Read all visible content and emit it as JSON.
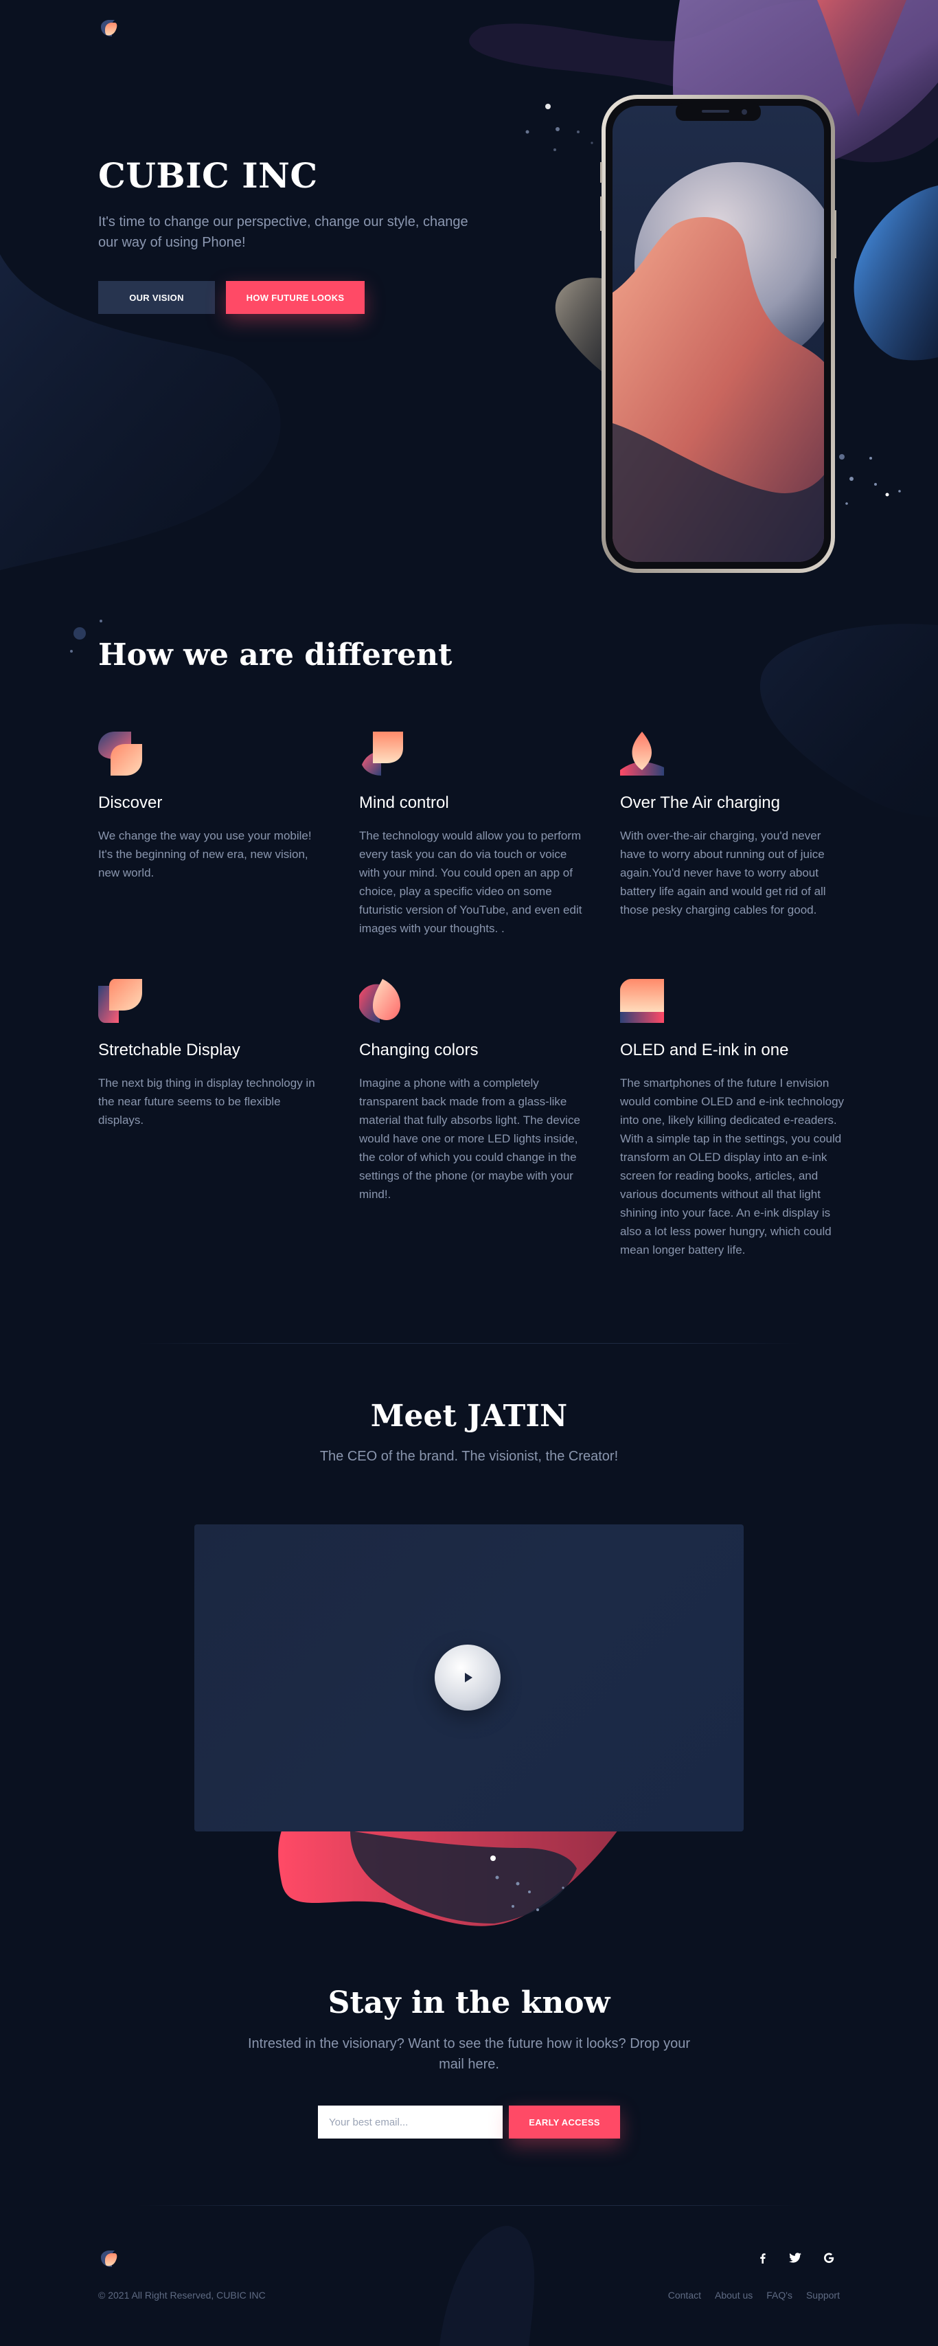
{
  "brand": {
    "name": "CUBIC INC",
    "logo_icon": "cubic-logo-icon"
  },
  "hero": {
    "title": "CUBIC INC",
    "text": "It's time to change our perspective, change our style, change our way of using Phone!",
    "btn_vision": "OUR VISION",
    "btn_future": "HOW FUTURE LOOKS"
  },
  "different": {
    "title": "How we are different",
    "features": [
      {
        "icon": "discover-icon",
        "title": "Discover",
        "text": "We change the way you use your mobile! It's the beginning of new era, new vision, new world."
      },
      {
        "icon": "mind-control-icon",
        "title": "Mind control",
        "text": "The technology would allow you to perform every task you can do via touch or voice with your mind. You could open an app of choice, play a specific video on some futuristic version of YouTube, and even edit images with your thoughts. ."
      },
      {
        "icon": "charging-icon",
        "title": "Over The Air charging",
        "text": "With over-the-air charging, you'd never have to worry about running out of juice again.You'd never have to worry about battery life again and would get rid of all those pesky charging cables for good."
      },
      {
        "icon": "stretchable-display-icon",
        "title": "Stretchable Display",
        "text": "The next big thing in display technology in the near future seems to be flexible displays."
      },
      {
        "icon": "changing-colors-icon",
        "title": "Changing colors",
        "text": "Imagine a phone with a completely transparent back made from a glass-like material that fully absorbs light. The device would have one or more LED lights inside, the color of which you could change in the settings of the phone (or maybe with your mind!."
      },
      {
        "icon": "oled-eink-icon",
        "title": "OLED and E-ink in one",
        "text": "The smartphones of the future I envision would combine OLED and e-ink technology into one, likely killing dedicated e-readers. With a simple tap in the settings, you could transform an OLED display into an e-ink screen for reading books, articles, and various documents without all that light shining into your face. An e-ink display is also a lot less power hungry, which could mean longer battery life."
      }
    ]
  },
  "meet": {
    "title": "Meet JATIN",
    "subtitle": "The CEO of the brand. The visionist, the Creator!",
    "play_icon": "play-icon"
  },
  "newsletter": {
    "title": "Stay in the know",
    "text": "Intrested in the visionary? Want to see the future how it looks? Drop your mail here.",
    "placeholder": "Your best email...",
    "button": "EARLY ACCESS"
  },
  "footer": {
    "copyright": "© 2021 All Right Reserved, CUBIC INC",
    "social": [
      {
        "icon": "facebook-icon",
        "glyph": "f"
      },
      {
        "icon": "twitter-icon",
        "glyph": "🐦"
      },
      {
        "icon": "google-icon",
        "glyph": "G"
      }
    ],
    "links": [
      "Contact",
      "About us",
      "FAQ's",
      "Support"
    ]
  },
  "colors": {
    "background": "#0a1120",
    "accent": "#ff4a66",
    "button_dark": "#27344f",
    "text_muted": "#8a96ae"
  }
}
